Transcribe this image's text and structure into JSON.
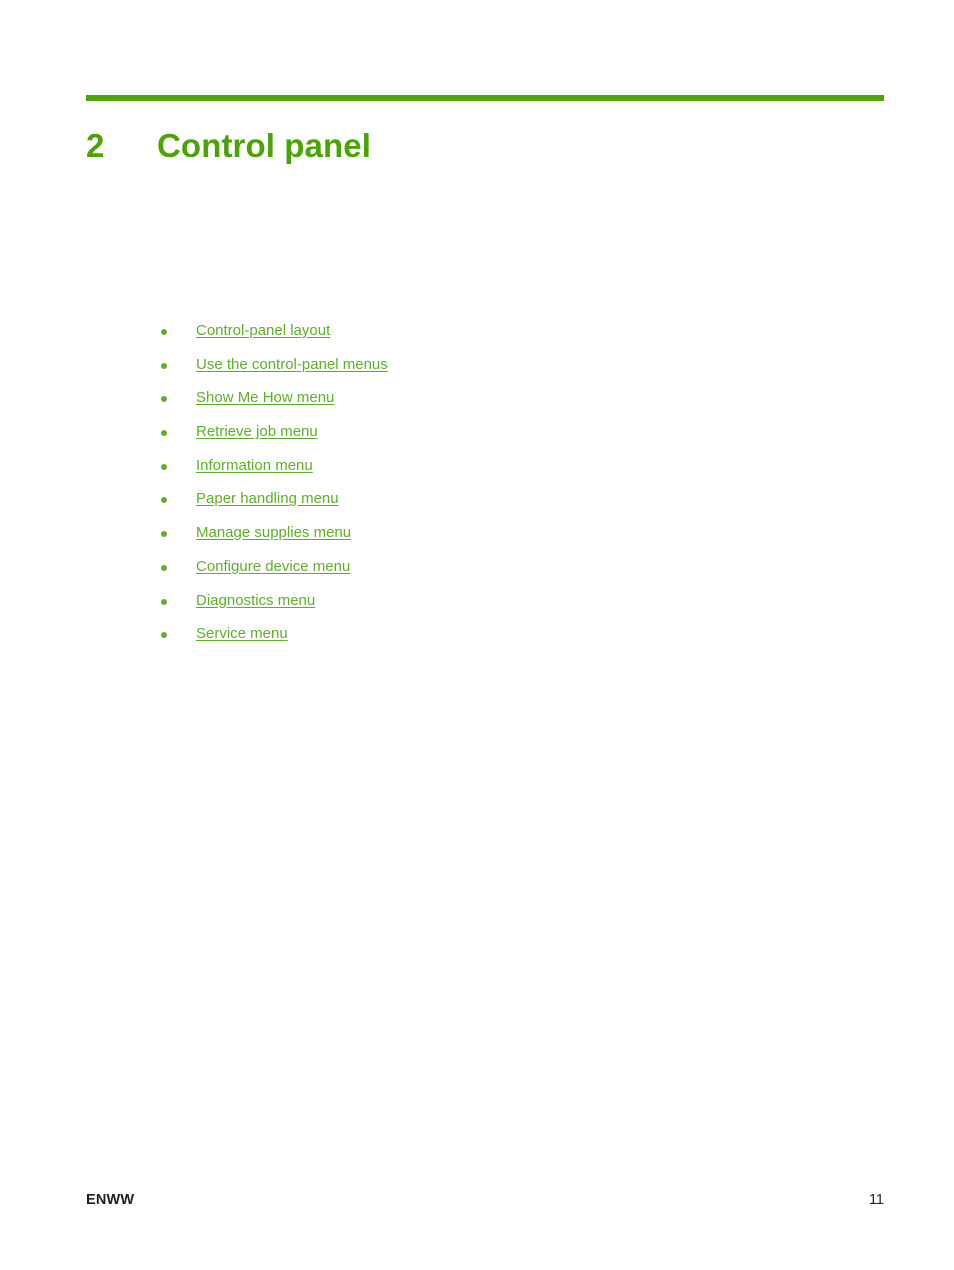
{
  "document": {
    "chapter_number": "2",
    "chapter_title": "Control panel"
  },
  "colors": {
    "rule": "#4CA503",
    "heading": "#49A503",
    "link": "#5CB226",
    "bullet": "#5DB227",
    "footer_text": "#231F20",
    "page_background": "#ffffff"
  },
  "toc": {
    "items": [
      {
        "label": "Control-panel layout"
      },
      {
        "label": "Use the control-panel menus"
      },
      {
        "label": "Show Me How menu"
      },
      {
        "label": "Retrieve job menu"
      },
      {
        "label": "Information menu"
      },
      {
        "label": "Paper handling menu"
      },
      {
        "label": "Manage supplies menu"
      },
      {
        "label": "Configure device menu"
      },
      {
        "label": "Diagnostics menu"
      },
      {
        "label": "Service menu"
      }
    ]
  },
  "footer": {
    "locale": "ENWW",
    "page_number": "11"
  }
}
